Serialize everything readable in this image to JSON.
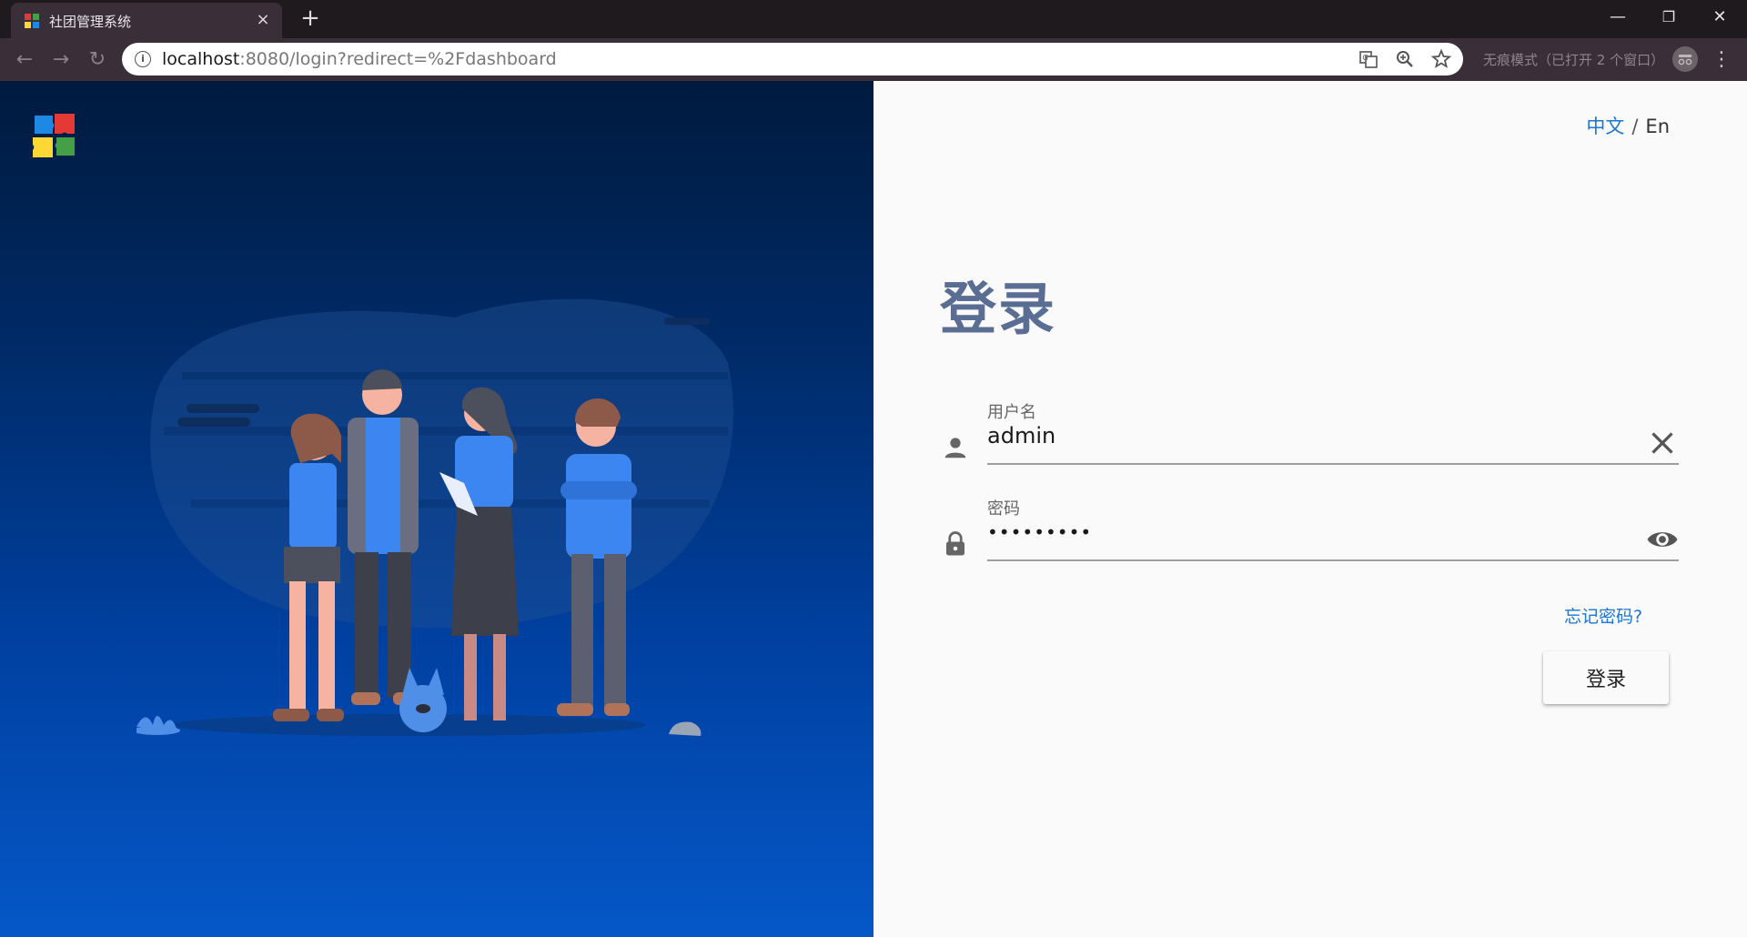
{
  "browser": {
    "tab_title": "社团管理系统",
    "tab_close": "×",
    "new_tab": "+",
    "url_host": "localhost",
    "url_rest": ":8080/login?redirect=%2Fdashboard",
    "incognito_text": "无痕模式（已打开 2 个窗口）",
    "window_minimize": "—",
    "window_restore": "❐",
    "window_close": "✕"
  },
  "language": {
    "zh": "中文",
    "separator": "/",
    "en": "En"
  },
  "login": {
    "heading": "登录",
    "username_label": "用户名",
    "username_value": "admin",
    "password_label": "密码",
    "password_value": "•••••••••",
    "forgot_password": "忘记密码?",
    "submit_label": "登录"
  },
  "colors": {
    "accent": "#1976d2",
    "heading": "#5a6e93",
    "panel_top": "#001a3e",
    "panel_bottom": "#0557c8"
  }
}
